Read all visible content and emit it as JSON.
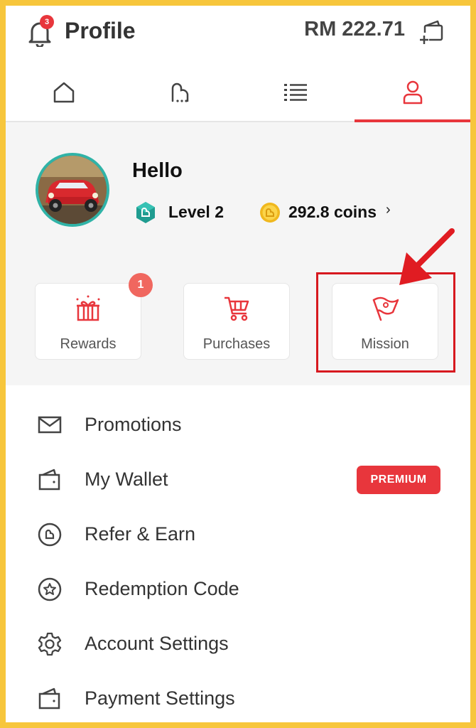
{
  "header": {
    "notification_count": "3",
    "title": "Profile",
    "balance": "RM 222.71"
  },
  "tabs": [
    {
      "icon": "home-icon"
    },
    {
      "icon": "coupon-icon"
    },
    {
      "icon": "list-icon"
    },
    {
      "icon": "user-icon",
      "active": true
    }
  ],
  "profile": {
    "greeting": "Hello",
    "level": "Level 2",
    "coins": "292.8 coins",
    "coins_chevron": "›"
  },
  "cards": {
    "rewards": {
      "label": "Rewards",
      "badge": "1"
    },
    "purchases": {
      "label": "Purchases"
    },
    "mission": {
      "label": "Mission"
    }
  },
  "menu": {
    "promotions": "Promotions",
    "wallet": "My Wallet",
    "wallet_badge": "PREMIUM",
    "refer": "Refer & Earn",
    "redemption": "Redemption Code",
    "account": "Account Settings",
    "payment": "Payment Settings"
  },
  "colors": {
    "accent": "#e8363c",
    "frame": "#f7c63c",
    "teal": "#30b3a7",
    "highlight": "#d7191f"
  }
}
